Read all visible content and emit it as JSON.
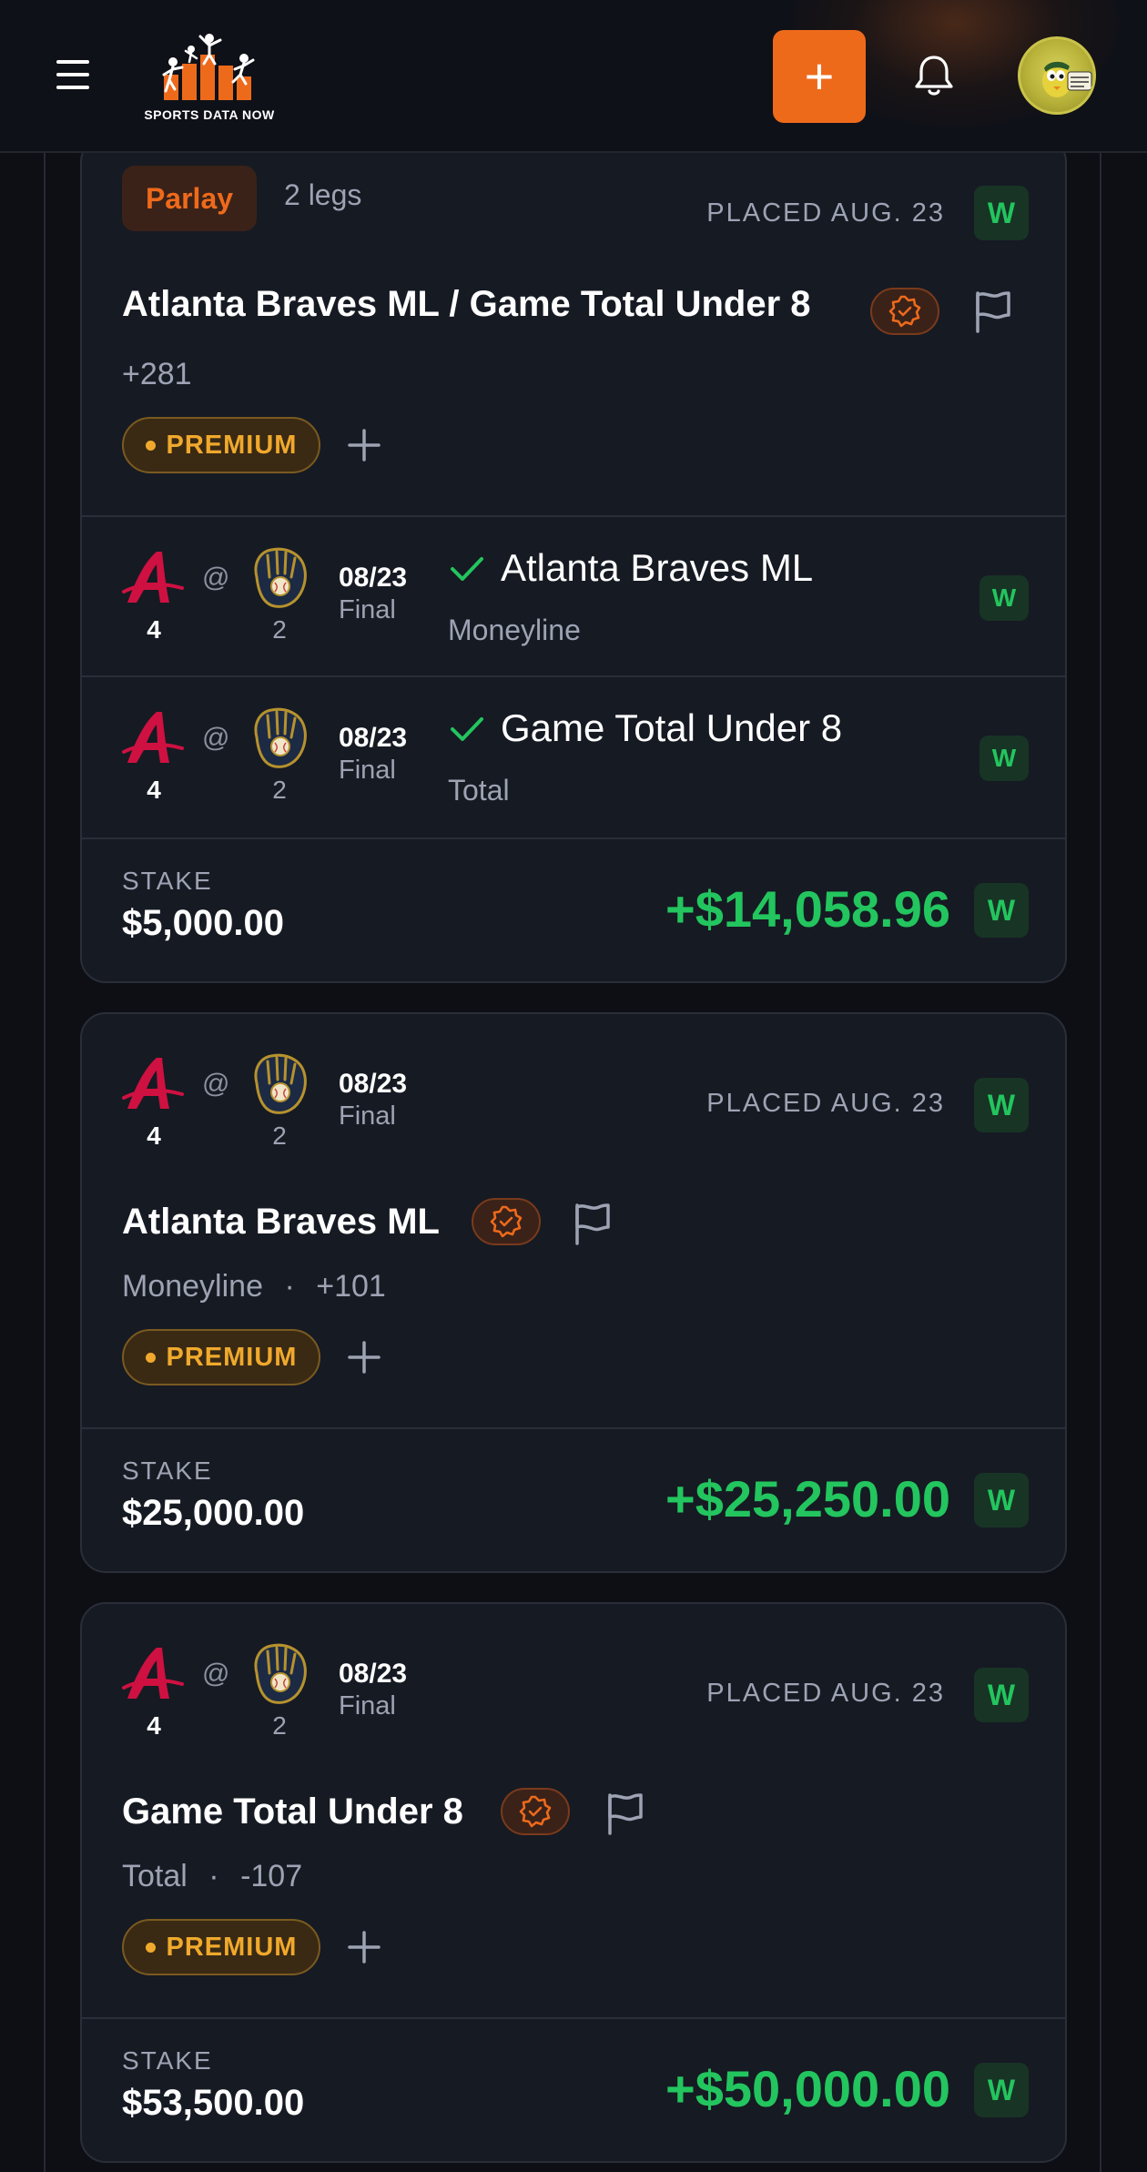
{
  "header": {
    "logo_text": "SPORTS DATA NOW",
    "add_label": "+"
  },
  "colors": {
    "accent": "#ee6a1b",
    "win": "#23c55e",
    "premium": "#f0a92c",
    "card_bg": "#161a23",
    "page_bg": "#0d0f15"
  },
  "parlay_card": {
    "badge": "Parlay",
    "legs_count": "2 legs",
    "placed": "PLACED AUG. 23",
    "result": "W",
    "title": "Atlanta Braves ML / Game Total Under 8",
    "odds": "+281",
    "tier": "PREMIUM",
    "legs": [
      {
        "away_score": "4",
        "at": "@",
        "home_score": "2",
        "date": "08/23",
        "status": "Final",
        "pick": "Atlanta Braves ML",
        "market": "Moneyline",
        "result": "W"
      },
      {
        "away_score": "4",
        "at": "@",
        "home_score": "2",
        "date": "08/23",
        "status": "Final",
        "pick": "Game Total Under 8",
        "market": "Total",
        "result": "W"
      }
    ],
    "stake_label": "STAKE",
    "stake": "$5,000.00",
    "payout": "+$14,058.96",
    "payout_result": "W"
  },
  "bet_cards": [
    {
      "away_score": "4",
      "at": "@",
      "home_score": "2",
      "date": "08/23",
      "status": "Final",
      "placed": "PLACED AUG. 23",
      "result": "W",
      "title": "Atlanta Braves ML",
      "market": "Moneyline",
      "separator": "·",
      "odds": "+101",
      "tier": "PREMIUM",
      "stake_label": "STAKE",
      "stake": "$25,000.00",
      "payout": "+$25,250.00",
      "payout_result": "W"
    },
    {
      "away_score": "4",
      "at": "@",
      "home_score": "2",
      "date": "08/23",
      "status": "Final",
      "placed": "PLACED AUG. 23",
      "result": "W",
      "title": "Game Total Under 8",
      "market": "Total",
      "separator": "·",
      "odds": "-107",
      "tier": "PREMIUM",
      "stake_label": "STAKE",
      "stake": "$53,500.00",
      "payout": "+$50,000.00",
      "payout_result": "W"
    }
  ],
  "icons": {
    "menu": "hamburger-icon",
    "notifications": "bell-icon",
    "verified": "verified-badge-icon",
    "report": "flag-icon",
    "add_to_slip": "plus-icon",
    "leg_won": "check-icon",
    "away_team": "atlanta-braves-logo",
    "home_team": "milwaukee-brewers-logo"
  }
}
